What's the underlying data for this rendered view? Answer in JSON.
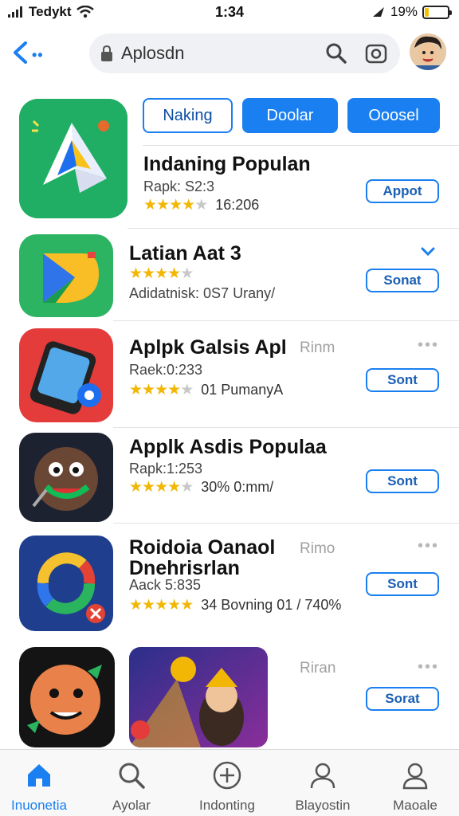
{
  "status_bar": {
    "carrier": "Tedykt",
    "time": "1:34",
    "battery": "19%",
    "battery_level": 0.19
  },
  "header": {
    "search_placeholder": "Aplosdn"
  },
  "tabs": [
    {
      "label": "Naking",
      "style": "outline"
    },
    {
      "label": "Doolar",
      "style": "filled"
    },
    {
      "label": "Ooosel",
      "style": "filled"
    }
  ],
  "apps": [
    {
      "title": "Indaning Populan",
      "meta": "Rapk: S2:3",
      "stars": 4,
      "stars_text": "16:206",
      "button": "Appot",
      "icon": "triangle-logo-icon"
    },
    {
      "title": "Latian Aat 3",
      "meta": "",
      "stars": 4,
      "stars_text": "",
      "meta2": "Adidatnisk:  0S7 Urany/",
      "button": "Sonat",
      "icon": "folder-arrow-icon"
    },
    {
      "title": "Aplpk Galsis Apl",
      "meta": "Raek:0:233",
      "stars": 4,
      "stars_text": "01 PumanyA",
      "label": "Rinm",
      "button": "Sont",
      "icon": "phone-icon"
    },
    {
      "title": "Applk Asdis Populaa",
      "meta": "Rapk:1:253",
      "stars": 4,
      "stars_text": "30% 0:mm/",
      "button": "Sont",
      "icon": "monster-character-icon"
    },
    {
      "title": "Roidoia Oanaol",
      "title2": "Dnehrisrlan",
      "meta": "Aack 5:835",
      "stars": 5,
      "stars_text": "34 Bovning 01 / 740%",
      "label": "Rimo",
      "button": "Sont",
      "icon": "sync-arrow-icon"
    },
    {
      "title": "",
      "label": "Riran",
      "button": "Sorat",
      "icon": "cartoon-face-icon"
    }
  ],
  "bottom_nav": [
    {
      "label": "Inuonetia",
      "icon": "home-icon",
      "active": true
    },
    {
      "label": "Ayolar",
      "icon": "search-icon",
      "active": false
    },
    {
      "label": "Indonting",
      "icon": "plus-circle-icon",
      "active": false
    },
    {
      "label": "Blayostin",
      "icon": "person-icon",
      "active": false
    },
    {
      "label": "Maoale",
      "icon": "profile-icon",
      "active": false
    }
  ],
  "colors": {
    "accent": "#1a7ff0",
    "star": "#f2b705"
  }
}
